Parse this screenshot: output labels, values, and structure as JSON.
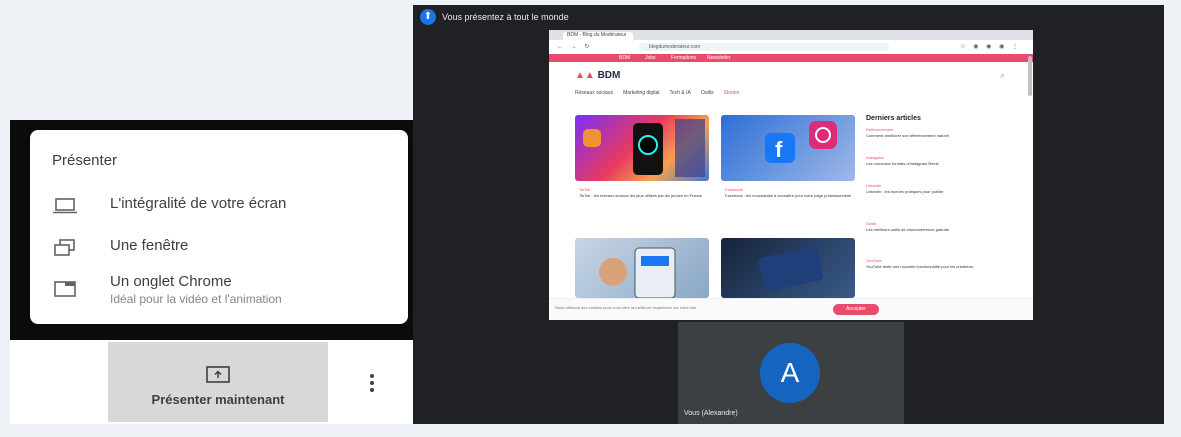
{
  "present_menu": {
    "title": "Présenter",
    "items": [
      {
        "icon": "laptop-icon",
        "label": "L'intégralité de votre écran"
      },
      {
        "icon": "window-icon",
        "label": "Une fenêtre"
      },
      {
        "icon": "tab-icon",
        "label": "Un onglet Chrome",
        "sublabel": "Idéal pour la vidéo et l'animation"
      }
    ]
  },
  "bottom_bar": {
    "present_now_label": "Présenter maintenant",
    "present_icon": "present-screen-icon",
    "more_icon": "more-vert-icon"
  },
  "meeting": {
    "banner_text": "Vous présentez à tout le monde",
    "participant_initial": "A",
    "participant_name": "Vous (Alexandre)"
  },
  "shared_page": {
    "tab_label": "BDM - Blog du Modérateur",
    "url": "blogdumoderateur.com",
    "nav_strip": [
      "BDM",
      "Jobs",
      "Formations",
      "Newsletter"
    ],
    "logo": "BDM",
    "menu": [
      "Réseaux sociaux",
      "Marketing digital",
      "Tech & IA",
      "Outils",
      "Stories"
    ],
    "articles": [
      {
        "category": "TikTok",
        "title": "TikTok : les réseaux sociaux les plus utilisés par les jeunes en France"
      },
      {
        "category": "Facebook",
        "title": "Facebook : les nouveautés à connaître pour votre page professionnelle"
      }
    ],
    "sidebar_title": "Derniers articles",
    "sidebar_items": [
      {
        "category": "Référencement",
        "title": "Comment améliorer son référencement naturel"
      },
      {
        "category": "Instagram",
        "title": "Les nouveaux formats d'Instagram Reels"
      },
      {
        "category": "LinkedIn",
        "title": "LinkedIn : les bonnes pratiques pour publier"
      },
      {
        "category": "Outils",
        "title": "Les meilleurs outils de visioconférence gratuits"
      },
      {
        "category": "YouTube",
        "title": "YouTube teste une nouvelle fonctionnalité pour les créateurs"
      }
    ],
    "cookie_text": "Nous utilisons des cookies pour vous offrir la meilleure expérience sur notre site.",
    "cookie_button": "Accepter"
  },
  "colors": {
    "accent_pink": "#e84c6c",
    "avatar_blue": "#1565c0",
    "dark_bg": "#202124"
  }
}
